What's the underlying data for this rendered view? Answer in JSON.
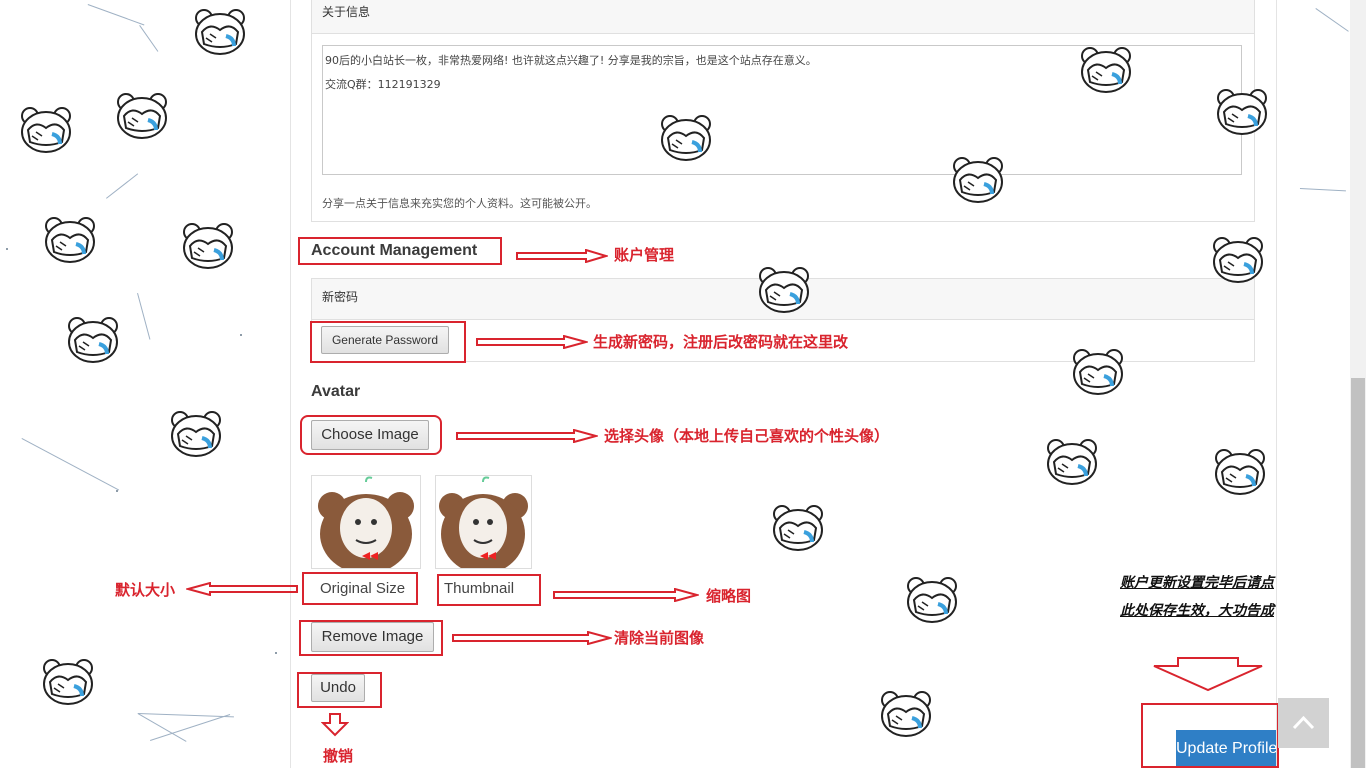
{
  "about": {
    "section_title": "关于信息",
    "bio_line1": "90后的小白站长一枚，非常热爱网络! 也许就这点兴趣了! 分享是我的宗旨，也是这个站点存在意义。",
    "bio_line2": "交流Q群：112191329",
    "hint": "分享一点关于信息来充实您的个人资料。这可能被公开。"
  },
  "account": {
    "heading": "Account Management",
    "new_password_label": "新密码",
    "generate_button": "Generate Password"
  },
  "avatar": {
    "heading": "Avatar",
    "choose_button": "Choose Image",
    "original_label": "Original Size",
    "thumbnail_label": "Thumbnail",
    "remove_button": "Remove Image",
    "undo_button": "Undo"
  },
  "annotations": {
    "account": "账户管理",
    "generate": "生成新密码，注册后改密码就在这里改",
    "choose": "选择头像（本地上传自己喜欢的个性头像）",
    "default_size": "默认大小",
    "thumbnail": "缩略图",
    "remove": "清除当前图像",
    "undo": "撤销",
    "save_line1": "账户更新设置完毕后请点",
    "save_line2": "此处保存生效，大功告成"
  },
  "update_button": "Update Profile",
  "colors": {
    "annotation_red": "#d9242e",
    "update_blue": "#2f7fc6"
  },
  "icons": {
    "mascot": "covering-face-bear-icon",
    "back_to_top": "chevron-up-icon"
  }
}
